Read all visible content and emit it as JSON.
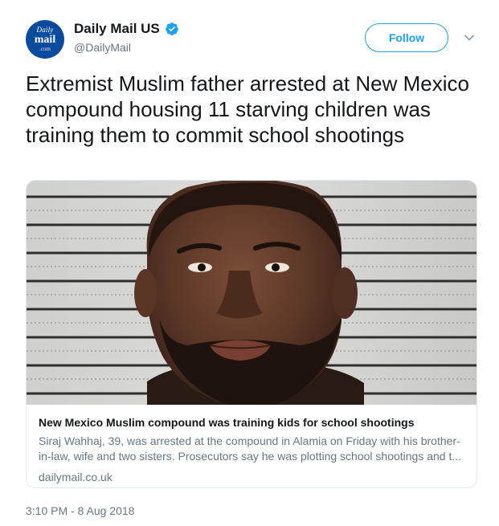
{
  "author": {
    "avatar_text": [
      "Daily",
      "mail",
      ".com"
    ],
    "display_name": "Daily Mail US",
    "handle": "@DailyMail",
    "verified_icon": "verified-badge-icon"
  },
  "follow_label": "Follow",
  "tweet_text": "Extremist Muslim father arrested at New Mexico compound housing 11 starving children was training them to commit school shootings",
  "card": {
    "title": "New Mexico Muslim compound was training kids for school shootings",
    "description": "Siraj Wahhaj, 39, was arrested at the compound in Alamia on Friday with his brother-in-law, wife and two sisters. Prosecutors say he was plotting school shootings and t...",
    "domain": "dailymail.co.uk"
  },
  "timestamp": "3:10 PM - 8 Aug 2018",
  "colors": {
    "accent": "#1da1f2",
    "text_primary": "#14171a",
    "text_secondary": "#657786",
    "card_border": "#e1e8ed",
    "avatar_bg": "#0a4b9e"
  }
}
